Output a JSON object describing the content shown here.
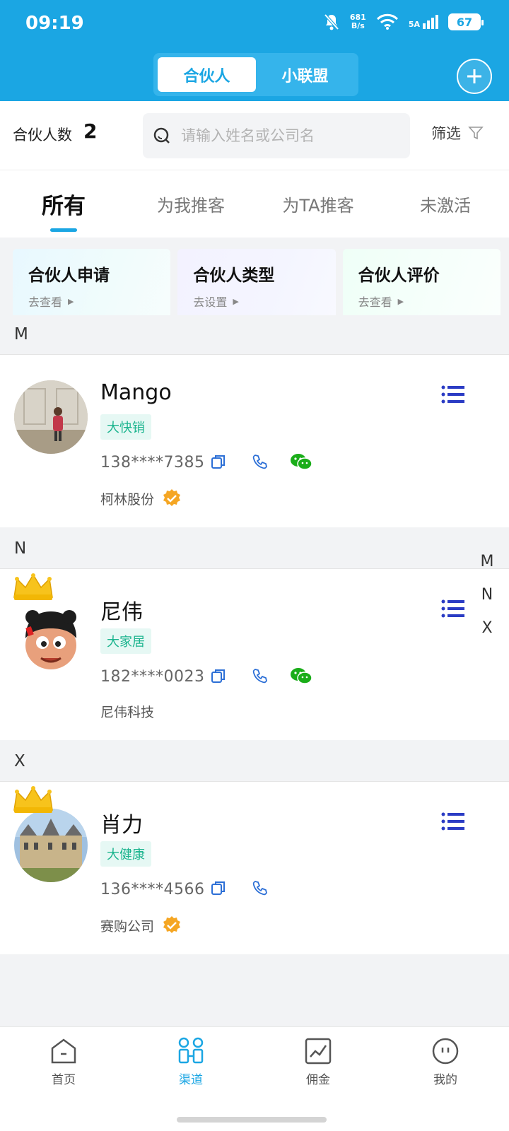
{
  "status_bar": {
    "time": "09:19",
    "net_speed_top": "681",
    "net_speed_bottom": "B/s",
    "network": "5A",
    "battery": "67"
  },
  "header": {
    "tabs": [
      "合伙人",
      "小联盟"
    ],
    "active_tab": 0
  },
  "toolbar": {
    "count_label": "合伙人数",
    "count": "2",
    "search_placeholder": "请输入姓名或公司名",
    "filter_label": "筛选"
  },
  "tabs": {
    "items": [
      "所有",
      "为我推客",
      "为TA推客",
      "未激活"
    ],
    "active": 0
  },
  "cards": [
    {
      "title": "合伙人申请",
      "link": "去查看"
    },
    {
      "title": "合伙人类型",
      "link": "去设置"
    },
    {
      "title": "合伙人评价",
      "link": "去查看"
    }
  ],
  "sections": [
    {
      "letter": "M",
      "contacts": [
        {
          "name": "Mango",
          "tag": "大快销",
          "phone": "138****7385",
          "company": "柯林股份",
          "verified": true,
          "wechat": true,
          "crown": false
        }
      ]
    },
    {
      "letter": "N",
      "contacts": [
        {
          "name": "尼伟",
          "tag": "大家居",
          "phone": "182****0023",
          "company": "尼伟科技",
          "verified": false,
          "wechat": true,
          "crown": true
        }
      ]
    },
    {
      "letter": "X",
      "contacts": [
        {
          "name": "肖力",
          "tag": "大健康",
          "phone": "136****4566",
          "company": "赛购公司",
          "verified": true,
          "wechat": false,
          "crown": true
        }
      ]
    }
  ],
  "index_bar": [
    "M",
    "N",
    "X"
  ],
  "bottom_nav": {
    "items": [
      "首页",
      "渠道",
      "佣金",
      "我的"
    ],
    "active": 1
  },
  "colors": {
    "primary": "#1ba6e3",
    "tag_text": "#1bb48e",
    "wechat": "#1aad19",
    "verified": "#f5a623",
    "menu_icon": "#2b3cc4"
  }
}
